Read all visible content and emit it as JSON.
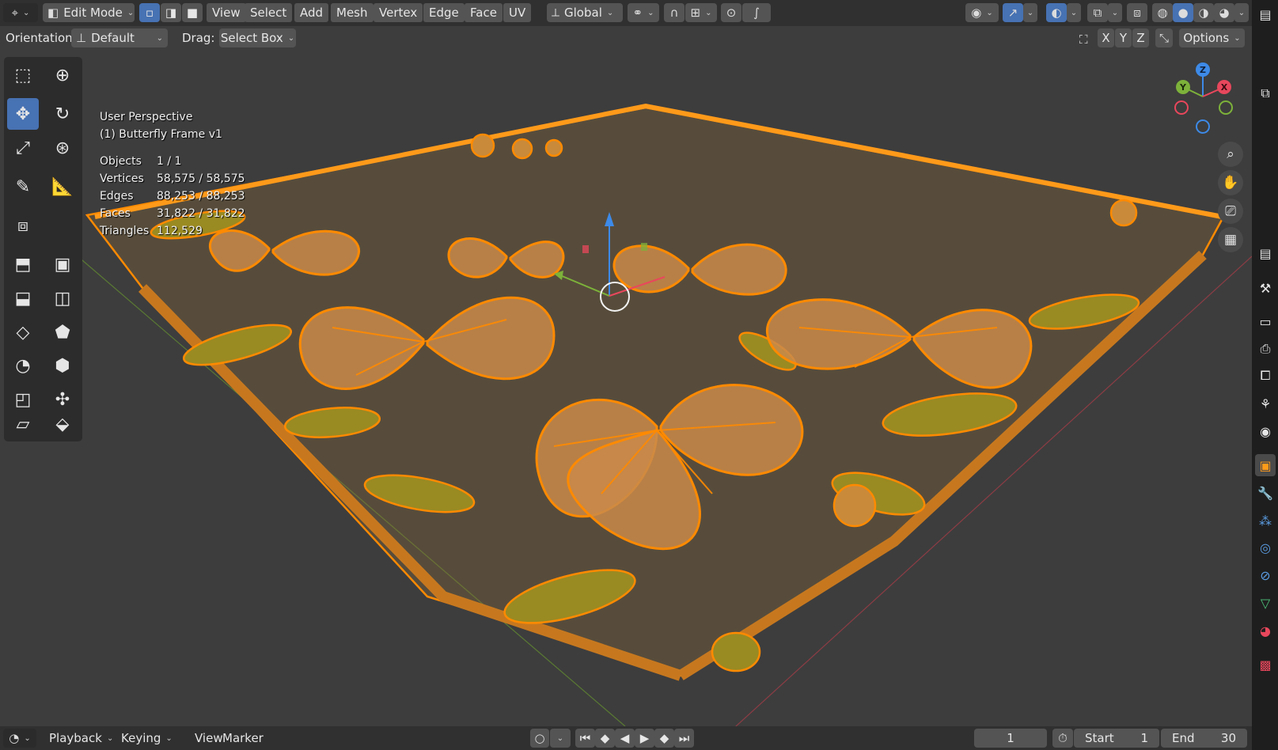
{
  "header": {
    "mode": "Edit Mode",
    "menus": [
      "View",
      "Select",
      "Add",
      "Mesh",
      "Vertex",
      "Edge",
      "Face",
      "UV"
    ],
    "transform_orientation": "Global"
  },
  "subheader": {
    "orientation_label": "Orientation:",
    "orientation_value": "Default",
    "drag_label": "Drag:",
    "drag_value": "Select Box",
    "axes": [
      "X",
      "Y",
      "Z"
    ],
    "options": "Options"
  },
  "overlay": {
    "view_name": "User Perspective",
    "object_name": "(1) Butterfly Frame v1",
    "stats": [
      {
        "key": "Objects",
        "value": "1 / 1"
      },
      {
        "key": "Vertices",
        "value": "58,575 / 58,575"
      },
      {
        "key": "Edges",
        "value": "88,253 / 88,253"
      },
      {
        "key": "Faces",
        "value": "31,822 / 31,822"
      },
      {
        "key": "Triangles",
        "value": "112,529"
      }
    ]
  },
  "gizmo": {
    "x": "X",
    "y": "Y",
    "z": "Z"
  },
  "timeline": {
    "menus": [
      "Playback",
      "Keying",
      "View",
      "Marker"
    ],
    "current_frame": "1",
    "start_label": "Start",
    "start_value": "1",
    "end_label": "End",
    "end_value": "30"
  },
  "colors": {
    "accent": "#4772b3",
    "selection": "#ff8a00",
    "x_axis": "#e8475c",
    "y_axis": "#7db23a",
    "z_axis": "#3d8ae8"
  }
}
